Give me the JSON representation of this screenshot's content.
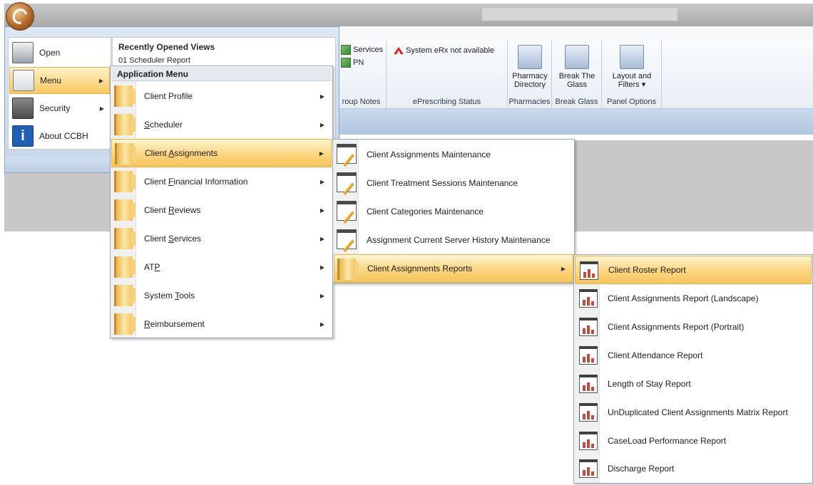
{
  "ribbon": {
    "services_label": "Services",
    "pn_label": "PN",
    "group_notes_label": "roup Notes",
    "erx_status_text": "System eRx not available",
    "eprescribing_label": "ePrescribing Status",
    "pharmacy_label_1": "Pharmacy",
    "pharmacy_label_2": "Directory",
    "pharmacies_label": "Pharmacies",
    "break_glass_label_1": "Break The",
    "break_glass_label_2": "Glass",
    "break_glass_group_label": "Break Glass",
    "layout_label_1": "Layout and",
    "layout_label_2": "Filters ▾",
    "panel_options_label": "Panel Options"
  },
  "app_menu": {
    "items": [
      {
        "label": "Open"
      },
      {
        "label": "Menu"
      },
      {
        "label": "Security"
      },
      {
        "label": "About CCBH"
      }
    ],
    "recent_title": "Recently Opened Views",
    "recent_item": "01 Scheduler Report"
  },
  "application_menu": {
    "title": "Application Menu",
    "items": [
      {
        "pre": "Client Profile",
        "key": "",
        "post": ""
      },
      {
        "pre": "",
        "key": "S",
        "post": "cheduler"
      },
      {
        "pre": "Client ",
        "key": "A",
        "post": "ssignments"
      },
      {
        "pre": "Client ",
        "key": "F",
        "post": "inancial Information"
      },
      {
        "pre": "Client ",
        "key": "R",
        "post": "eviews"
      },
      {
        "pre": "Client ",
        "key": "S",
        "post": "ervices"
      },
      {
        "pre": "AT",
        "key": "P",
        "post": ""
      },
      {
        "pre": "System ",
        "key": "T",
        "post": "ools"
      },
      {
        "pre": "",
        "key": "R",
        "post": "eimbursement"
      }
    ]
  },
  "client_assignments_menu": {
    "items": [
      {
        "label": "Client Assignments Maintenance"
      },
      {
        "label": "Client Treatment Sessions Maintenance"
      },
      {
        "label": "Client Categories Maintenance"
      },
      {
        "label": "Assignment Current Server History Maintenance"
      },
      {
        "label": "Client Assignments Reports"
      }
    ]
  },
  "reports_menu": {
    "items": [
      {
        "label": "Client Roster Report"
      },
      {
        "label": "Client Assignments Report (Landscape)"
      },
      {
        "label": "Client Assignments Report (Portrait)"
      },
      {
        "label": "Client Attendance Report"
      },
      {
        "label": "Length of Stay Report"
      },
      {
        "label": "UnDuplicated Client Assignments Matrix Report"
      },
      {
        "label": "CaseLoad Performance Report"
      },
      {
        "label": "Discharge Report"
      }
    ]
  },
  "colors": {
    "highlight": "#f9c85e",
    "ribbon_band": "#b2c6e0",
    "menu_frame": "#c7d6ea"
  }
}
